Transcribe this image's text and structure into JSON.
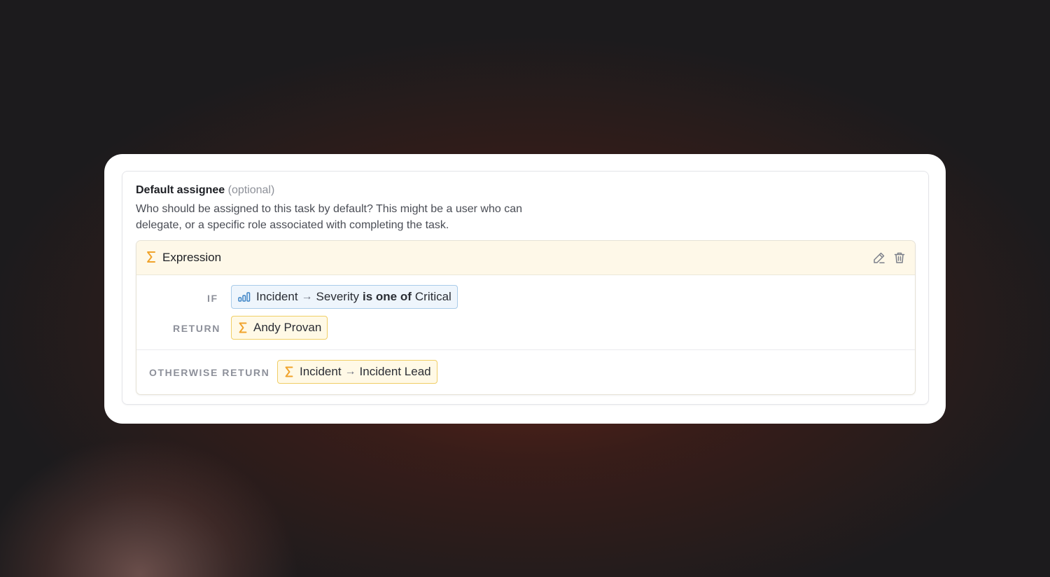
{
  "field": {
    "title": "Default assignee",
    "optional": "(optional)",
    "description": "Who should be assigned to this task by default? This might be a user who can delegate, or a specific role associated with completing the task."
  },
  "expression": {
    "header_label": "Expression",
    "header_icon": "sigma-icon",
    "edit_icon": "pencil-icon",
    "delete_icon": "trash-icon",
    "condition": {
      "keyword": "IF",
      "icon": "bar-chart-icon",
      "subject": "Incident",
      "field": "Severity",
      "operator": "is one of",
      "value": "Critical"
    },
    "return": {
      "keyword": "RETURN",
      "value": "Andy Provan"
    },
    "otherwise": {
      "keyword": "OTHERWISE RETURN",
      "subject": "Incident",
      "field": "Incident Lead"
    }
  },
  "colors": {
    "sigma": "#f0a32b",
    "expression_header_bg": "#fef8e8",
    "blue_pill_bg": "#eef5fc",
    "yellow_pill_bg": "#fff9e6",
    "icon_blue": "#3d84c6"
  }
}
